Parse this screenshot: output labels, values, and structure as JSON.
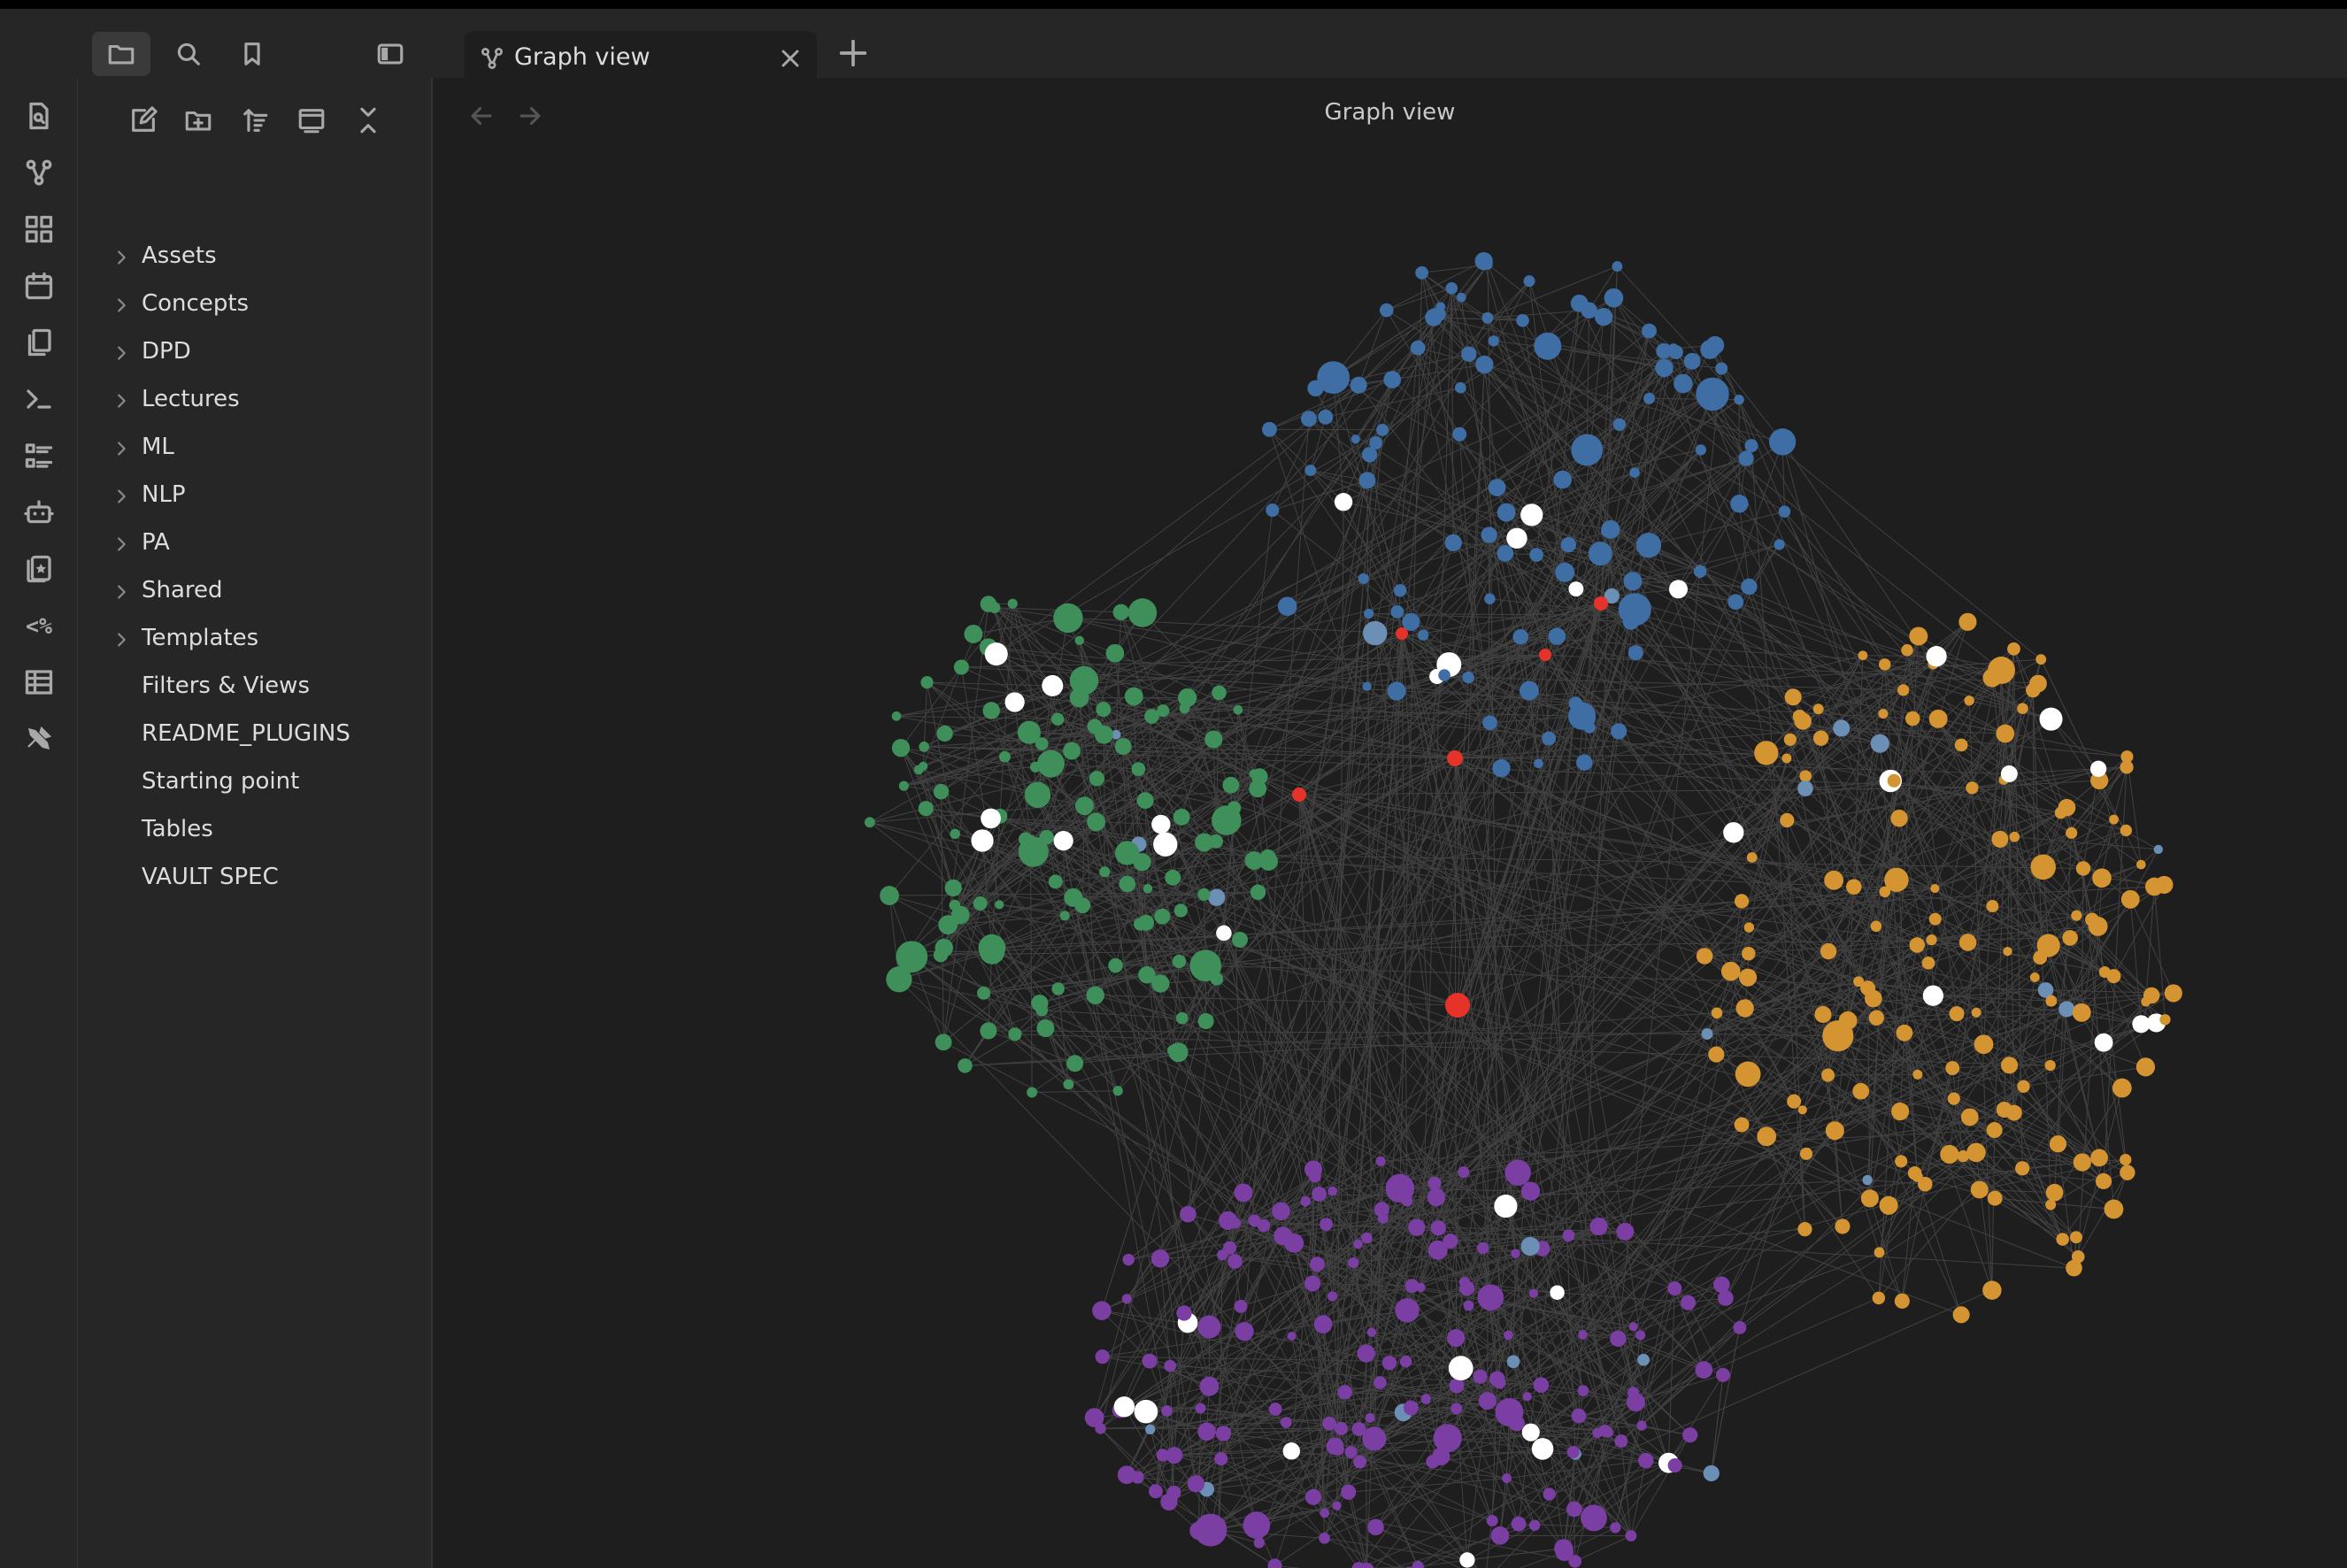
{
  "tab": {
    "title": "Graph view"
  },
  "view": {
    "title": "Graph view"
  },
  "sidebar": {
    "tree": [
      {
        "label": "Assets",
        "folder": true
      },
      {
        "label": "Concepts",
        "folder": true
      },
      {
        "label": "DPD",
        "folder": true
      },
      {
        "label": "Lectures",
        "folder": true
      },
      {
        "label": "ML",
        "folder": true
      },
      {
        "label": "NLP",
        "folder": true
      },
      {
        "label": "PA",
        "folder": true
      },
      {
        "label": "Shared",
        "folder": true
      },
      {
        "label": "Templates",
        "folder": true
      },
      {
        "label": "Filters & Views",
        "folder": false
      },
      {
        "label": "README_PLUGINS",
        "folder": false
      },
      {
        "label": "Starting point",
        "folder": false
      },
      {
        "label": "Tables",
        "folder": false
      },
      {
        "label": "VAULT SPEC",
        "folder": false
      }
    ]
  },
  "ribbon": {
    "items": [
      {
        "icon": "file-search-icon"
      },
      {
        "icon": "graph-icon"
      },
      {
        "icon": "canvas-icon"
      },
      {
        "icon": "calendar-icon"
      },
      {
        "icon": "copy-icon"
      },
      {
        "icon": "terminal-icon"
      },
      {
        "icon": "list-icon"
      },
      {
        "icon": "bot-icon"
      },
      {
        "icon": "cards-icon"
      },
      {
        "icon": "templater-icon",
        "text": "<%"
      },
      {
        "icon": "table-icon"
      },
      {
        "icon": "tools-icon"
      }
    ]
  },
  "graph": {
    "clusters": [
      {
        "name": "blue",
        "color": "#3e6ea3"
      },
      {
        "name": "green",
        "color": "#3f8f5a"
      },
      {
        "name": "orange",
        "color": "#d49432"
      },
      {
        "name": "purple",
        "color": "#7b3fa3"
      }
    ],
    "special_colors": {
      "hub": "#e5332a",
      "unresolved": "#ffffff",
      "attachment": "#6c8fb5",
      "edge": "#555555",
      "background": "#1e1e1e"
    }
  }
}
